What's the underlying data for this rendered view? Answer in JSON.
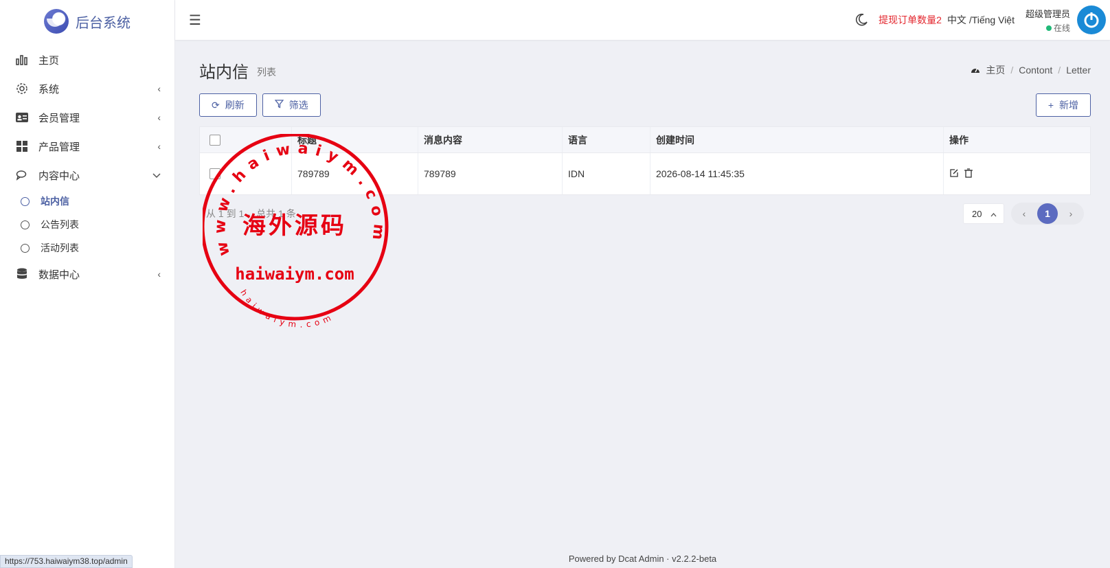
{
  "brand": {
    "name": "后台系统"
  },
  "sidebar": {
    "items": [
      {
        "label": "主页",
        "icon": "bar-chart-icon",
        "chev": ""
      },
      {
        "label": "系统",
        "icon": "gear-icon",
        "chev": "‹"
      },
      {
        "label": "会员管理",
        "icon": "id-card-icon",
        "chev": "‹"
      },
      {
        "label": "产品管理",
        "icon": "grid-icon",
        "chev": "‹"
      },
      {
        "label": "内容中心",
        "icon": "chat-icon",
        "chev": "⌄"
      }
    ],
    "subitems": [
      {
        "label": "站内信"
      },
      {
        "label": "公告列表"
      },
      {
        "label": "活动列表"
      }
    ],
    "after": {
      "label": "数据中心",
      "icon": "database-icon",
      "chev": "‹"
    }
  },
  "header": {
    "withdraw": "提现订单数量2",
    "lang": "中文 /Tiếng Việt",
    "user_name": "超级管理员",
    "user_status": "在线"
  },
  "page": {
    "title": "站内信",
    "subtitle": "列表",
    "breadcrumb": [
      "主页",
      "Contont",
      "Letter"
    ]
  },
  "toolbar": {
    "refresh": "刷新",
    "filter": "筛选",
    "add": "新增"
  },
  "table": {
    "headers": [
      "标题",
      "消息内容",
      "语言",
      "创建时间",
      "操作"
    ],
    "rows": [
      {
        "title": "789789",
        "content": "789789",
        "lang": "IDN",
        "created": "2026-08-14 11:45:35"
      }
    ]
  },
  "pagination": {
    "total_text": "从 1 到 1 ，总共 1 条",
    "per_page": "20",
    "current": "1"
  },
  "watermark": {
    "arc": "www.haiwaiym.com",
    "center": "海外源码",
    "domain": "haiwaiym.com",
    "small": "haiwaiym.com"
  },
  "footer": {
    "text": "Powered by Dcat Admin  ·  v2.2.2-beta"
  },
  "statusbar": {
    "url": "https://753.haiwaiym38.top/admin"
  },
  "colors": {
    "primary": "#4c60a3",
    "danger": "#e3262d",
    "online": "#21b978"
  }
}
